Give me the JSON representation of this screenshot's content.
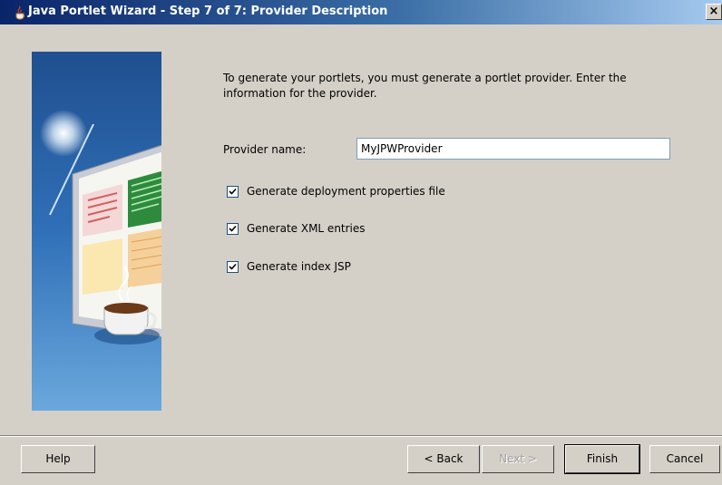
{
  "window": {
    "title": "Java Portlet Wizard - Step 7 of 7: Provider Description",
    "close_label": "×"
  },
  "main": {
    "instruction": "To generate your portlets, you must generate a portlet provider. Enter the information for the provider.",
    "provider_name_label": "Provider name:",
    "provider_name_value": "MyJPWProvider",
    "checkboxes": [
      {
        "label": "Generate deployment properties file",
        "checked": true
      },
      {
        "label": "Generate XML entries",
        "checked": true
      },
      {
        "label": "Generate index JSP",
        "checked": true
      }
    ]
  },
  "buttons": {
    "help": "Help",
    "back": "< Back",
    "next": "Next >",
    "finish": "Finish",
    "cancel": "Cancel"
  },
  "colors": {
    "dialog_bg": "#d4d0c8",
    "title_start": "#0a246a",
    "title_end": "#a6caf0",
    "image_panel": "#2a5ea8"
  },
  "icons": {
    "app": "java-coffee-cup-icon",
    "close": "close-icon",
    "check": "checkmark-icon"
  }
}
